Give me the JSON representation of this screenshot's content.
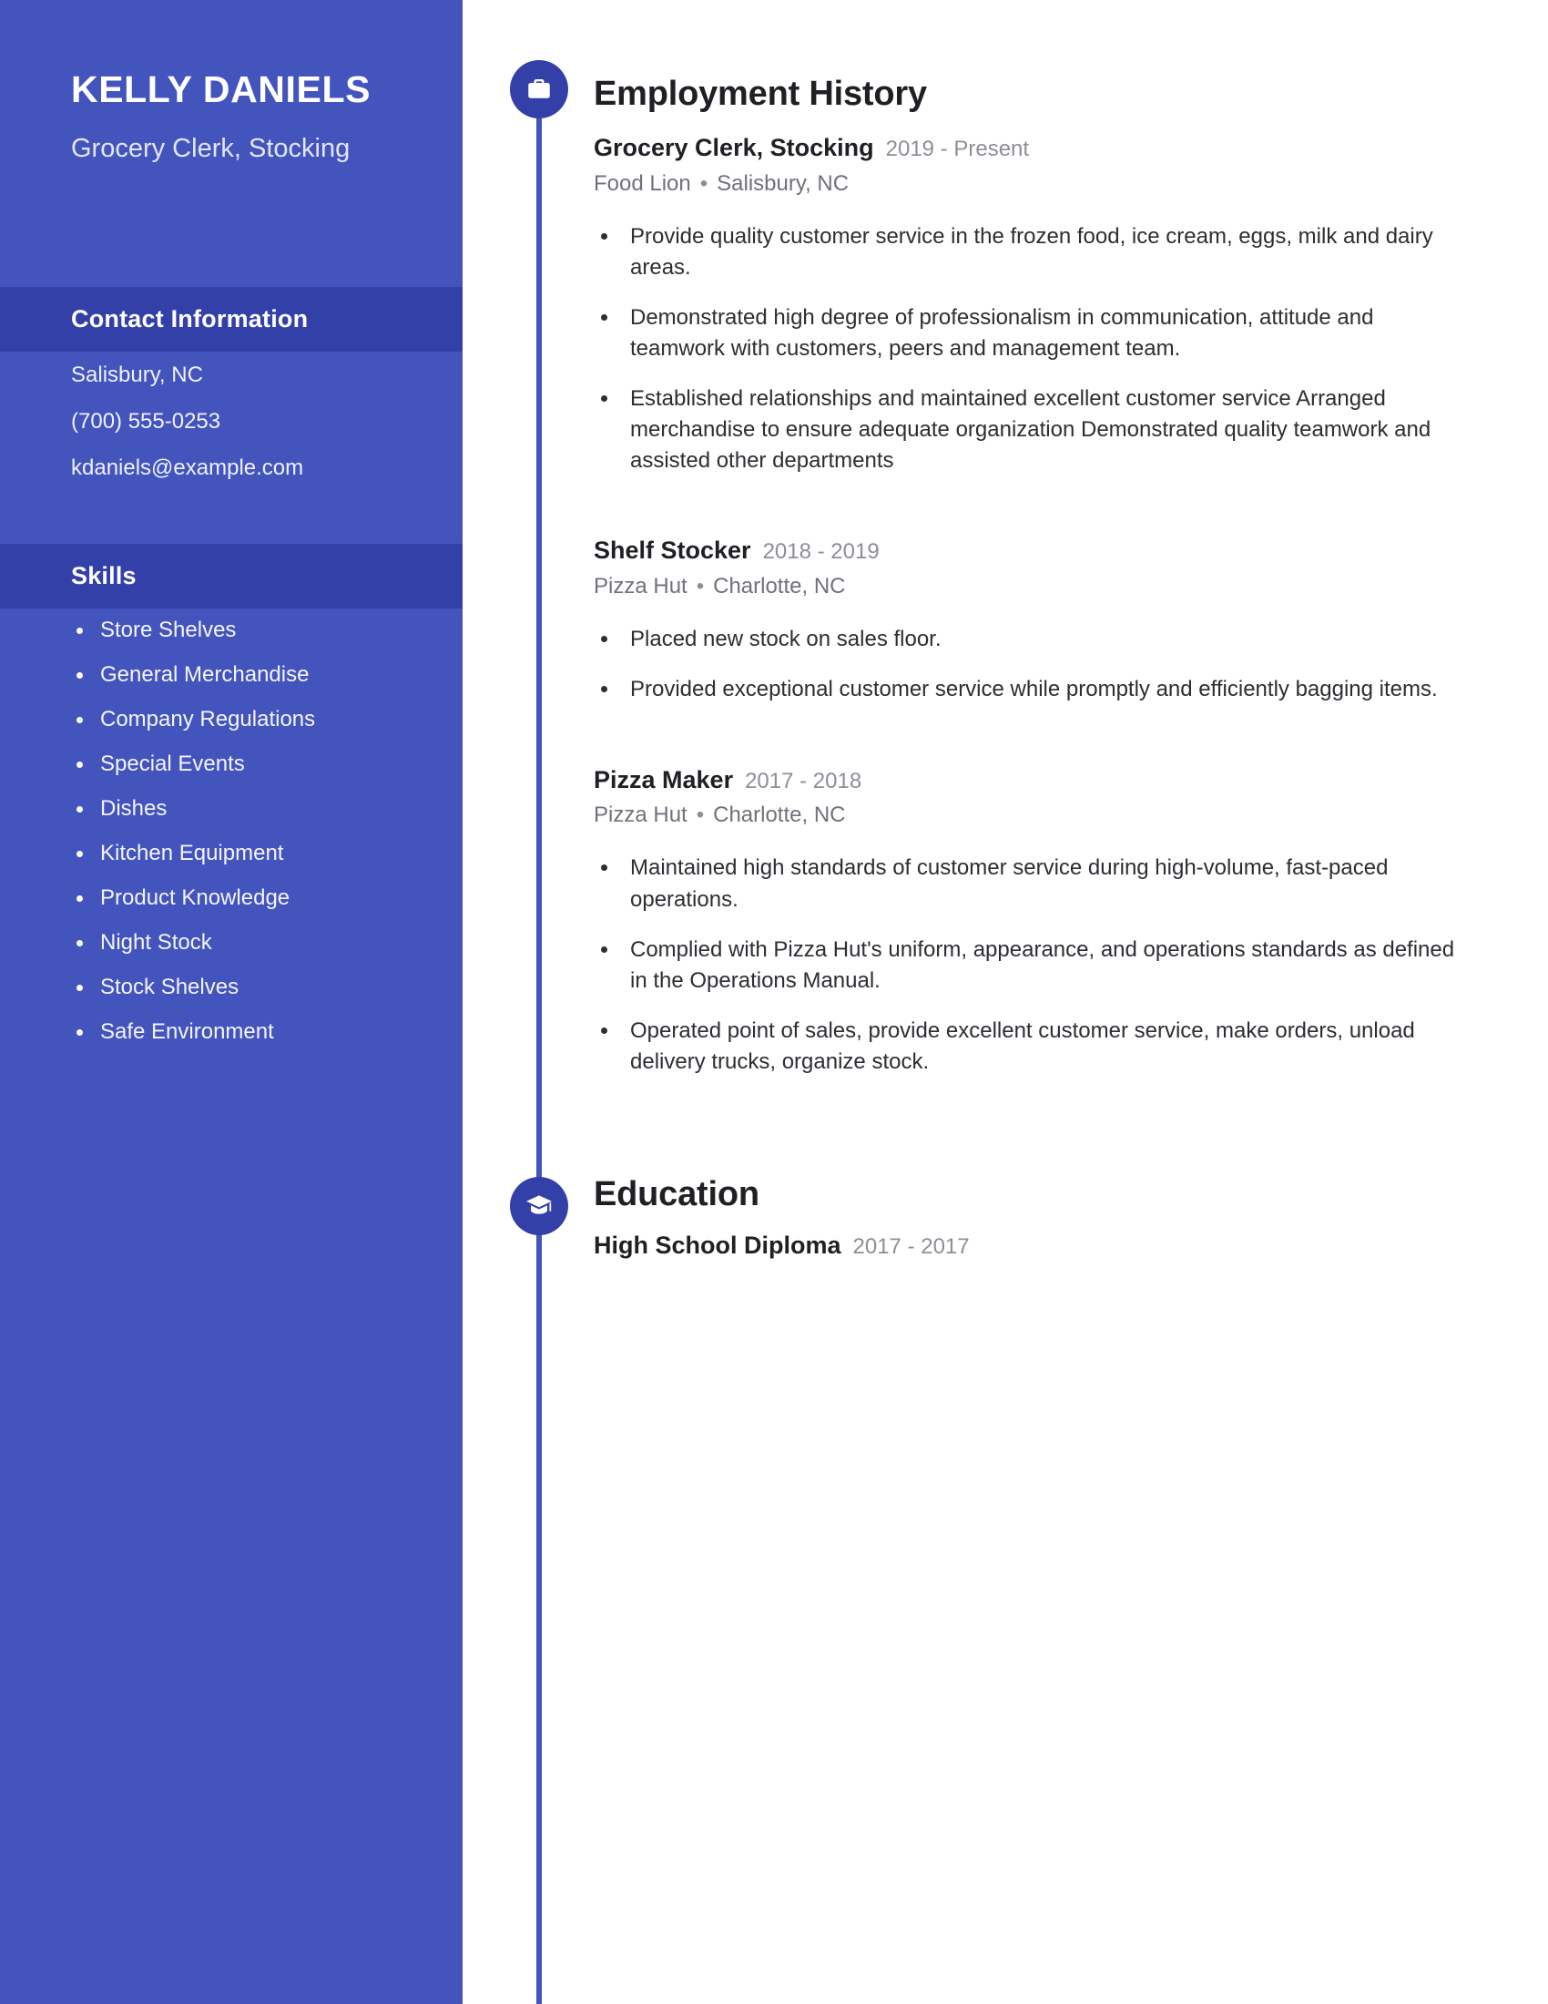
{
  "theme": {
    "sidebar_bg": "#4354bd",
    "band_bg": "#3340a8",
    "marker_bg": "#3340a8",
    "page_bg": "#ffffff",
    "heading_color": "#1f2024",
    "muted_color": "#8c8f96"
  },
  "sidebar": {
    "name": "KELLY DANIELS",
    "job_title": "Grocery Clerk, Stocking",
    "contact": {
      "heading": "Contact Information",
      "lines": [
        "Salisbury, NC",
        "(700) 555-0253",
        "kdaniels@example.com"
      ]
    },
    "skills": {
      "heading": "Skills",
      "items": [
        "Store Shelves",
        "General Merchandise",
        "Company Regulations",
        "Special Events",
        "Dishes",
        "Kitchen Equipment",
        "Product Knowledge",
        "Night Stock",
        "Stock Shelves",
        "Safe Environment"
      ]
    }
  },
  "main": {
    "employment": {
      "heading": "Employment History",
      "icon": "briefcase-icon",
      "entries": [
        {
          "role": "Grocery Clerk, Stocking",
          "dates": "2019 - Present",
          "company": "Food Lion",
          "location": "Salisbury, NC",
          "bullets": [
            "Provide quality customer service in the frozen food, ice cream, eggs, milk and dairy areas.",
            "Demonstrated high degree of professionalism in communication, attitude and teamwork with customers, peers and management team.",
            "Established relationships and maintained excellent customer service Arranged merchandise to ensure adequate organization Demonstrated quality teamwork and assisted other departments"
          ]
        },
        {
          "role": "Shelf Stocker",
          "dates": "2018 - 2019",
          "company": "Pizza Hut",
          "location": "Charlotte, NC",
          "bullets": [
            "Placed new stock on sales floor.",
            "Provided exceptional customer service while promptly and efficiently bagging items."
          ]
        },
        {
          "role": "Pizza Maker",
          "dates": "2017 - 2018",
          "company": "Pizza Hut",
          "location": "Charlotte, NC",
          "bullets": [
            "Maintained high standards of customer service during high-volume, fast-paced operations.",
            "Complied with Pizza Hut's uniform, appearance, and operations standards as defined in the Operations Manual.",
            "Operated point of sales, provide excellent customer service, make orders, unload delivery trucks, organize stock."
          ]
        }
      ]
    },
    "education": {
      "heading": "Education",
      "icon": "graduation-cap-icon",
      "entries": [
        {
          "role": "High School Diploma",
          "dates": "2017 - 2017"
        }
      ]
    }
  },
  "separator": "•"
}
